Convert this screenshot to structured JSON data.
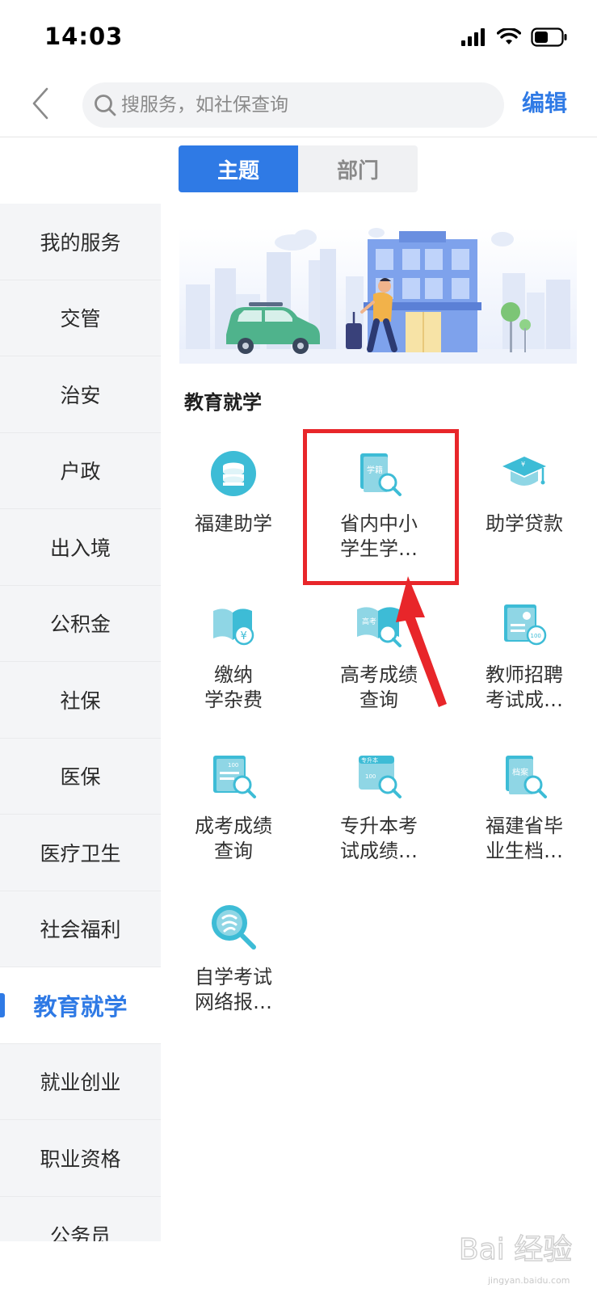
{
  "status_bar": {
    "time": "14:03"
  },
  "header": {
    "search_placeholder": "搜服务，如社保查询",
    "edit_label": "编辑"
  },
  "tabs": [
    {
      "label": "主题",
      "active": true
    },
    {
      "label": "部门",
      "active": false
    }
  ],
  "sidebar": {
    "items": [
      {
        "label": "我的服务"
      },
      {
        "label": "交管"
      },
      {
        "label": "治安"
      },
      {
        "label": "户政"
      },
      {
        "label": "出入境"
      },
      {
        "label": "公积金"
      },
      {
        "label": "社保"
      },
      {
        "label": "医保"
      },
      {
        "label": "医疗卫生"
      },
      {
        "label": "社会福利"
      },
      {
        "label": "教育就学",
        "active": true
      },
      {
        "label": "就业创业"
      },
      {
        "label": "职业资格"
      },
      {
        "label": "公务员"
      }
    ]
  },
  "section_title": "教育就学",
  "services": [
    {
      "label": "福建助学",
      "icon": "coin-stack-icon"
    },
    {
      "label": "省内中小\n学生学…",
      "icon": "book-search-icon",
      "badge": "学籍"
    },
    {
      "label": "助学贷款",
      "icon": "graduation-cap-icon"
    },
    {
      "label": "缴纳\n学杂费",
      "icon": "book-yuan-icon"
    },
    {
      "label": "高考成绩\n查询",
      "icon": "book-search-icon",
      "badge": "高考"
    },
    {
      "label": "教师招聘\n考试成…",
      "icon": "id-card-score-icon"
    },
    {
      "label": "成考成绩\n查询",
      "icon": "certificate-search-icon"
    },
    {
      "label": "专升本考\n试成绩…",
      "icon": "scroll-search-icon",
      "badge": "专升本"
    },
    {
      "label": "福建省毕\n业生档…",
      "icon": "archive-search-icon",
      "badge": "档案"
    },
    {
      "label": "自学考试\n网络报…",
      "icon": "magnifier-icon"
    }
  ],
  "colors": {
    "accent": "#2f7ae5",
    "icon_teal": "#3dbcd6",
    "highlight_red": "#e8262a"
  },
  "watermark": {
    "brand": "Bai 经验",
    "domain": "jingyan.baidu.com"
  }
}
